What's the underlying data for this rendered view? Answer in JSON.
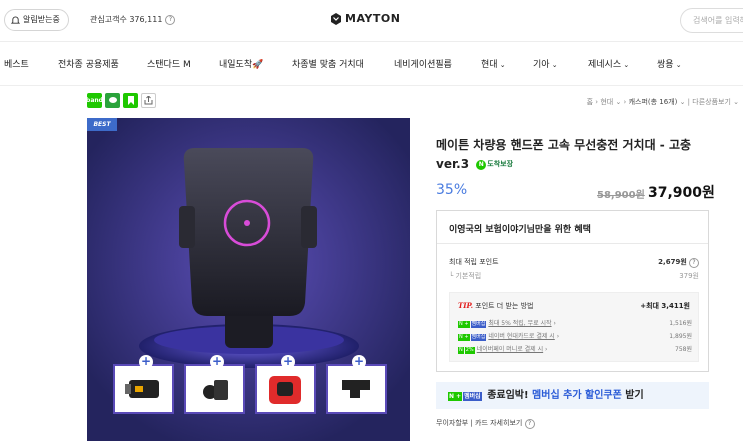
{
  "topbar": {
    "alarm_label": "알림받는중",
    "interest_label": "관심고객수 376,111",
    "question": "?",
    "logo_text": "MAYTON",
    "search_placeholder": "검색어를 입력해"
  },
  "nav": {
    "items": [
      "베스트",
      "전차종 공용제품",
      "스탠다드 M",
      "내일도착",
      "차종별 맞춤 거치대",
      "네비게이션필름",
      "현대",
      "기아",
      "제네시스",
      "쌍용"
    ]
  },
  "breadcrumb": {
    "home": "홈",
    "cat1": "현대",
    "cat2": "캐스퍼(총 16개)",
    "sort": "다른상품보기"
  },
  "share": {
    "items": [
      "band",
      "kakao",
      "bookmark",
      "share"
    ]
  },
  "hero": {
    "best_label": "BEST",
    "thumbs": [
      "charger",
      "clip",
      "holder",
      "mount"
    ]
  },
  "product": {
    "title": "메이튼 차량용 핸드폰 고속 무선충전 거치대 - 고충 ver.3",
    "delivery_badge": "도착보장",
    "discount": "35%",
    "original_price": "58,900원",
    "price": "37,900원"
  },
  "benefit": {
    "header": "이영국의 보험이야기님만을 위한 혜택",
    "max_points_label": "최대 적립 포인트",
    "max_points_value": "2,679원",
    "base_label": "기본적립",
    "base_value": "379원",
    "tip_prefix": "TIP.",
    "tip_title": "포인트 더 받는 방법",
    "tip_total": "+최대 3,411원",
    "tip_rows": [
      {
        "label": "최대 5% 적립, 무료 시작",
        "value": "1,516원",
        "badge": "멤버십"
      },
      {
        "label": "네이버 현대카드로 결제 시",
        "value": "1,895원",
        "badge": "멤버십"
      },
      {
        "label": "네이버페이 머니로 결제 시",
        "value": "758원",
        "badge": "2%"
      }
    ]
  },
  "coupon": {
    "badge": "멤버십",
    "text_a": "종료임박!",
    "text_b": "멤버십 추가 할인쿠폰",
    "text_c": "받기"
  },
  "installment": {
    "label": "무이자할부",
    "link": "카드 자세히보기"
  },
  "colors": {
    "accent": "#3b5dc9",
    "naver_green": "#1ec800",
    "discount": "#4a7ce0",
    "tip_red": "#e21d1d"
  }
}
